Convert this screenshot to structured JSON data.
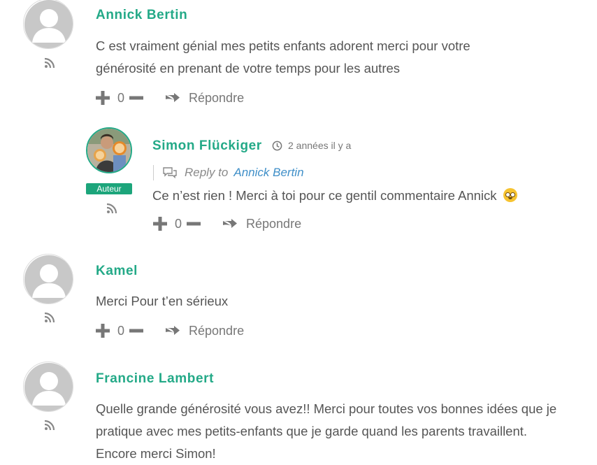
{
  "comments": [
    {
      "author": "Annick Bertin",
      "text": "C est vraiment génial mes petits enfants adorent merci pour votre générosité en prenant de votre temps pour les autres",
      "vote_count": "0",
      "reply_label": "Répondre"
    },
    {
      "author": "Simon Flückiger",
      "badge": "Auteur",
      "timestamp": "2 années il y a",
      "reply_to_label": "Reply to",
      "reply_to_author": "Annick Bertin",
      "text": "Ce n’est rien ! Merci à toi pour ce gentil commentaire Annick",
      "emoji": "flushed-smiley",
      "vote_count": "0",
      "reply_label": "Répondre"
    },
    {
      "author": "Kamel",
      "text": "Merci Pour t’en sérieux",
      "vote_count": "0",
      "reply_label": "Répondre"
    },
    {
      "author": "Francine Lambert",
      "text": "Quelle grande générosité vous avez!! Merci pour toutes vos bonnes idées que je pratique avec mes petits-enfants que je garde quand les parents travaillent. Encore merci Simon!"
    }
  ],
  "colors": {
    "author": "#23a987",
    "badge": "#1ca57b",
    "link": "#3f8fc8",
    "text": "#555555",
    "icon": "#777777"
  }
}
